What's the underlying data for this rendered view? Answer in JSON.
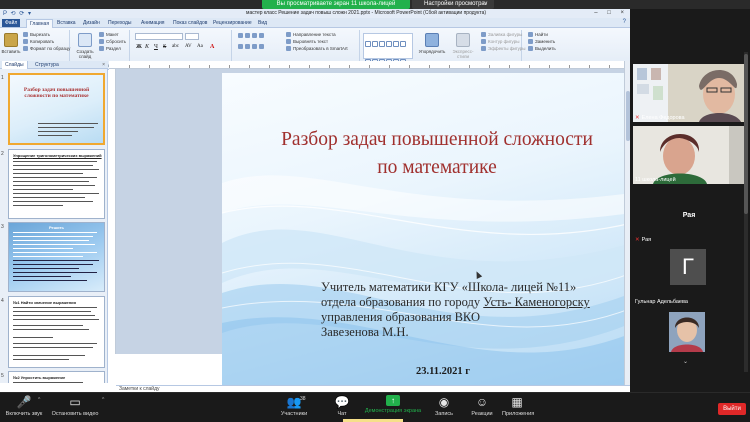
{
  "share_banner": {
    "green_text": "Вы просматриваете экран 11 школа-лицей",
    "settings_text": "Настройки просмотра",
    "settings_caret": "∨"
  },
  "ppt": {
    "title": "мастер класс Решение задач повыш сложн 2021.pptx  -  Microsoft PowerPoint (Сбой активации продукта)",
    "qat": "P ⟲ ⟳ ▾",
    "window_controls": "– □ ×",
    "tabs": [
      "Файл",
      "Главная",
      "Вставка",
      "Дизайн",
      "Переходы",
      "Анимация",
      "Показ слайдов",
      "Рецензирование",
      "Вид"
    ],
    "active_tab": "Главная",
    "help_icon": "?",
    "ribbon": {
      "clipboard": {
        "paste": "Вставить",
        "cut": "Вырезать",
        "copy": "Копировать",
        "format": "Формат по образцу",
        "group": "Буфер обмена"
      },
      "slides": {
        "new_slide": "Создать слайд",
        "layout": "Макет",
        "reset": "Сбросить",
        "section": "Раздел",
        "group": "Слайды"
      },
      "font": {
        "font_name": "",
        "font_size": "",
        "bold": "Ж",
        "italic": "К",
        "underline": "Ч",
        "strike": "S",
        "shadow": "abc",
        "spacing": "AV",
        "case": "Aa",
        "color": "A",
        "group": "Шрифт"
      },
      "paragraph": {
        "text_direction": "Направление текста",
        "align_text": "Выровнять текст",
        "smartart": "Преобразовать в SmartArt",
        "group": "Абзац"
      },
      "drawing": {
        "arrange": "Упорядочить",
        "quick_styles": "Экспресс-стили",
        "shape_fill": "Заливка фигуры",
        "shape_outline": "Контур фигуры",
        "shape_effects": "Эффекты фигуры",
        "group": "Рисование"
      },
      "editing": {
        "find": "Найти",
        "replace": "Заменить",
        "select": "Выделить",
        "group": "Редактирование"
      }
    },
    "panel_tabs": [
      "Слайды",
      "Структура"
    ],
    "panel_close": "×",
    "thumb_numbers": [
      "1",
      "2",
      "3",
      "4",
      "5"
    ],
    "thumb1_title": "Разбор задач повышенной сложности по математике",
    "thumb2_heading": "Упрощение тригонометрических выражений",
    "thumb3_heading": "Решить",
    "thumb4_heading": "№1 Найти значение выражения",
    "thumb5_heading": "№2 Упростить выражение",
    "slide": {
      "title_line1": "Разбор задач повышенной сложности",
      "title_line2": "по математике",
      "body_line1": "Учитель математики КГУ «Школа- лицей №11»",
      "body_line2_a": "отдела образования по городу ",
      "body_line2_u": "Усть- Каменогорску",
      "body_line3": "управления образования ВКО",
      "body_line4": "Завезенова М.Н.",
      "date": "23.11.2021 г"
    },
    "notes_placeholder": "Заметки к слайду"
  },
  "gallery": {
    "participants": [
      {
        "name": "Елена Федорова",
        "muted": true
      },
      {
        "name": "11 школа-лицей",
        "muted": false
      },
      {
        "name": "Рая",
        "muted": true,
        "audio_only": true
      },
      {
        "name": "Гульнар Адельбаева",
        "muted": false,
        "initial": "Г"
      },
      {
        "name": "",
        "muted": false
      }
    ],
    "scroll_chevron": "⌄"
  },
  "toolbar": {
    "unmute": "Включить звук",
    "stop_video": "Остановить видео",
    "participants": "Участники",
    "participants_count": "38",
    "chat": "Чат",
    "share": "Демонстрация экрана",
    "record": "Запись",
    "reactions": "Реакции",
    "apps": "Приложения",
    "leave": "Выйти"
  },
  "colors": {
    "slide_title": "#a0302e",
    "share_green": "#22b14c",
    "leave_red": "#e02828"
  }
}
